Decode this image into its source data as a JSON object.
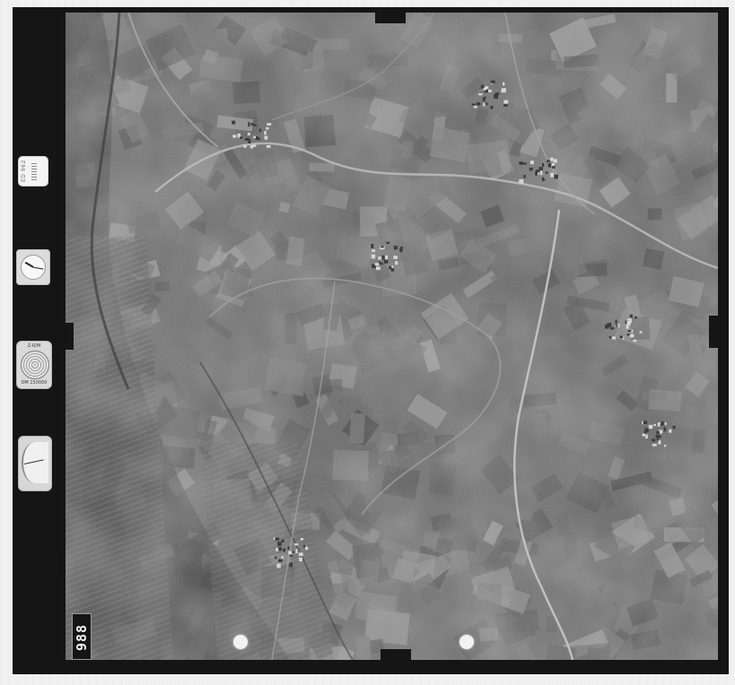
{
  "image": {
    "kind": "aerial survey photograph",
    "tone": "black-and-white",
    "scene": "agricultural landscape with field patchwork, roads, a river valley, railway and small villages"
  },
  "frame": {
    "frame_number": "988"
  },
  "strip": {
    "counter_text": "ED 962",
    "clock_label": "",
    "altimeter_top": "Z-R/M",
    "altimeter_bottom": "DM 150000"
  },
  "colors": {
    "film_border": "#151515",
    "margin": "#f1f1f1"
  }
}
